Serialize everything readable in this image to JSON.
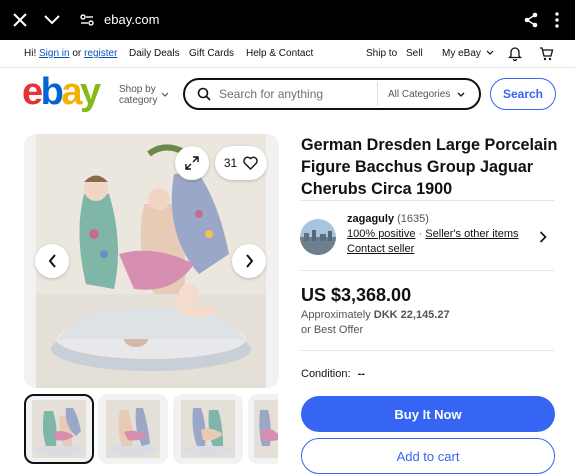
{
  "browser": {
    "url": "ebay.com"
  },
  "topnav": {
    "greeting": "Hi!",
    "signin": "Sign in",
    "or": "or",
    "register": "register",
    "daily_deals": "Daily Deals",
    "gift_cards": "Gift Cards",
    "help_contact": "Help & Contact",
    "ship_to": "Ship to",
    "sell": "Sell",
    "my_ebay": "My eBay"
  },
  "header": {
    "logo": [
      "e",
      "b",
      "a",
      "y"
    ],
    "logo_colors": [
      "#e53238",
      "#0064d2",
      "#f5af02",
      "#86b817"
    ],
    "shop_by_line1": "Shop by",
    "shop_by_line2": "category",
    "search_placeholder": "Search for anything",
    "category_select": "All Categories",
    "search_button": "Search"
  },
  "gallery": {
    "watch_count": "31",
    "thumbnails": 4
  },
  "listing": {
    "title": "German Dresden Large Porcelain Figure Bacchus Group Jaguar Cherubs Circa 1900",
    "seller_name": "zagaguly",
    "seller_feedback": "(1635)",
    "positive": "100% positive",
    "other_items": "Seller's other items",
    "contact": "Contact seller",
    "price": "US $3,368.00",
    "approx_label": "Approximately",
    "approx_value": "DKK 22,145.27",
    "best_offer": "or Best Offer",
    "condition_label": "Condition:",
    "condition_value": "--",
    "buy_now": "Buy It Now",
    "add_to_cart": "Add to cart"
  },
  "colors": {
    "accent": "#3665f3",
    "link": "#0654ba"
  }
}
